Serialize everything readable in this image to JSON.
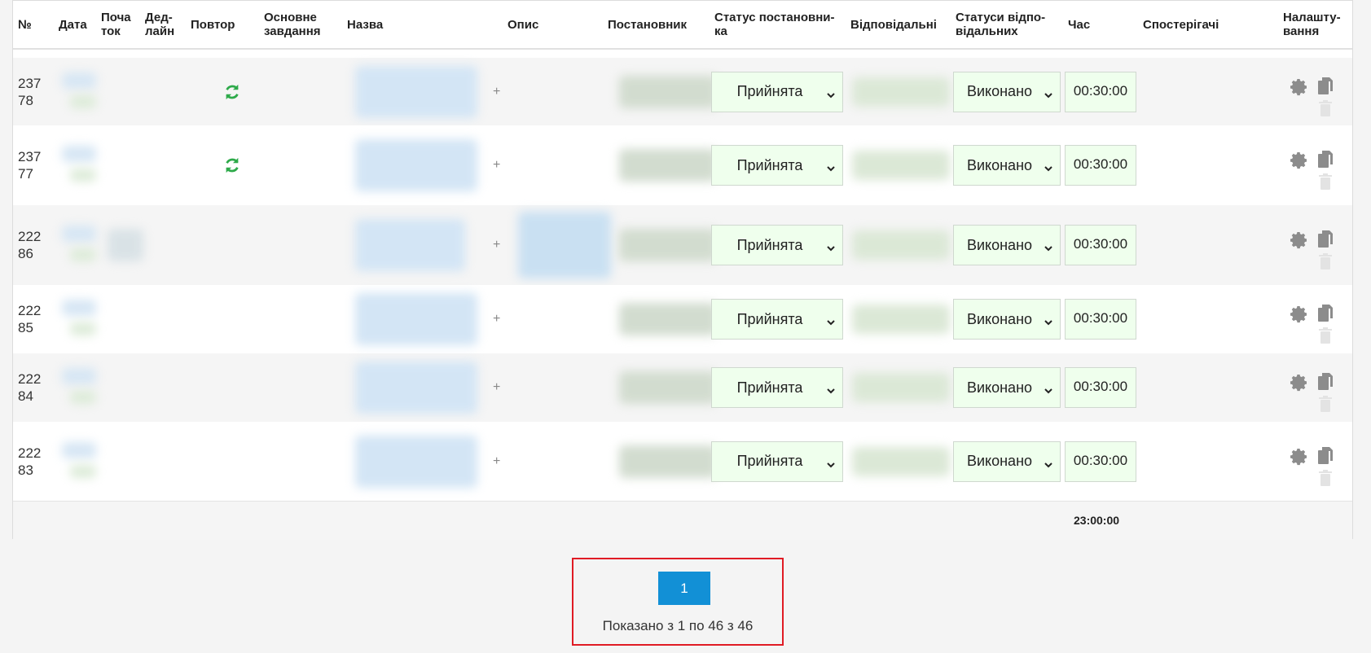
{
  "columns": {
    "num": "№",
    "date": "Дата",
    "start": "Поча\nток",
    "deadline": "Дед-\nлайн",
    "repeat": "Повтор",
    "main_task": "Основне\nзавдання",
    "name": "Назва",
    "description": "Опис",
    "author": "Постановник",
    "author_status": "Статус постановни-\nка",
    "responsible": "Відповідальні",
    "responsible_status": "Статуси відпо-\nвідальних",
    "time": "Час",
    "watchers": "Спостерігачі",
    "settings": "Налашту-\nвання"
  },
  "rows": [
    {
      "id": "23778",
      "repeat": true,
      "has_description": false,
      "author_status": "Прийнята",
      "responsible_status": "Виконано",
      "time": "00:30:00"
    },
    {
      "id": "23777",
      "repeat": true,
      "has_description": false,
      "author_status": "Прийнята",
      "responsible_status": "Виконано",
      "time": "00:30:00"
    },
    {
      "id": "22286",
      "repeat": false,
      "has_description": true,
      "author_status": "Прийнята",
      "responsible_status": "Виконано",
      "time": "00:30:00"
    },
    {
      "id": "22285",
      "repeat": false,
      "has_description": false,
      "author_status": "Прийнята",
      "responsible_status": "Виконано",
      "time": "00:30:00"
    },
    {
      "id": "22284",
      "repeat": false,
      "has_description": false,
      "author_status": "Прийнята",
      "responsible_status": "Виконано",
      "time": "00:30:00"
    },
    {
      "id": "22283",
      "repeat": false,
      "has_description": false,
      "author_status": "Прийнята",
      "responsible_status": "Виконано",
      "time": "00:30:00"
    }
  ],
  "plus_glyph": "+",
  "footer": {
    "total_time": "23:00:00"
  },
  "pagination": {
    "current_page": "1",
    "summary": "Показано з 1 по 46 з 46"
  },
  "icons": {
    "repeat": "refresh-icon",
    "settings": "gear-icon",
    "copy": "copy-icon",
    "delete": "trash-icon"
  },
  "colors": {
    "status_bg": "#efffed",
    "repeat_icon": "#2eaa4a",
    "page_button": "#1290d6",
    "highlight_border": "#e01b24"
  }
}
